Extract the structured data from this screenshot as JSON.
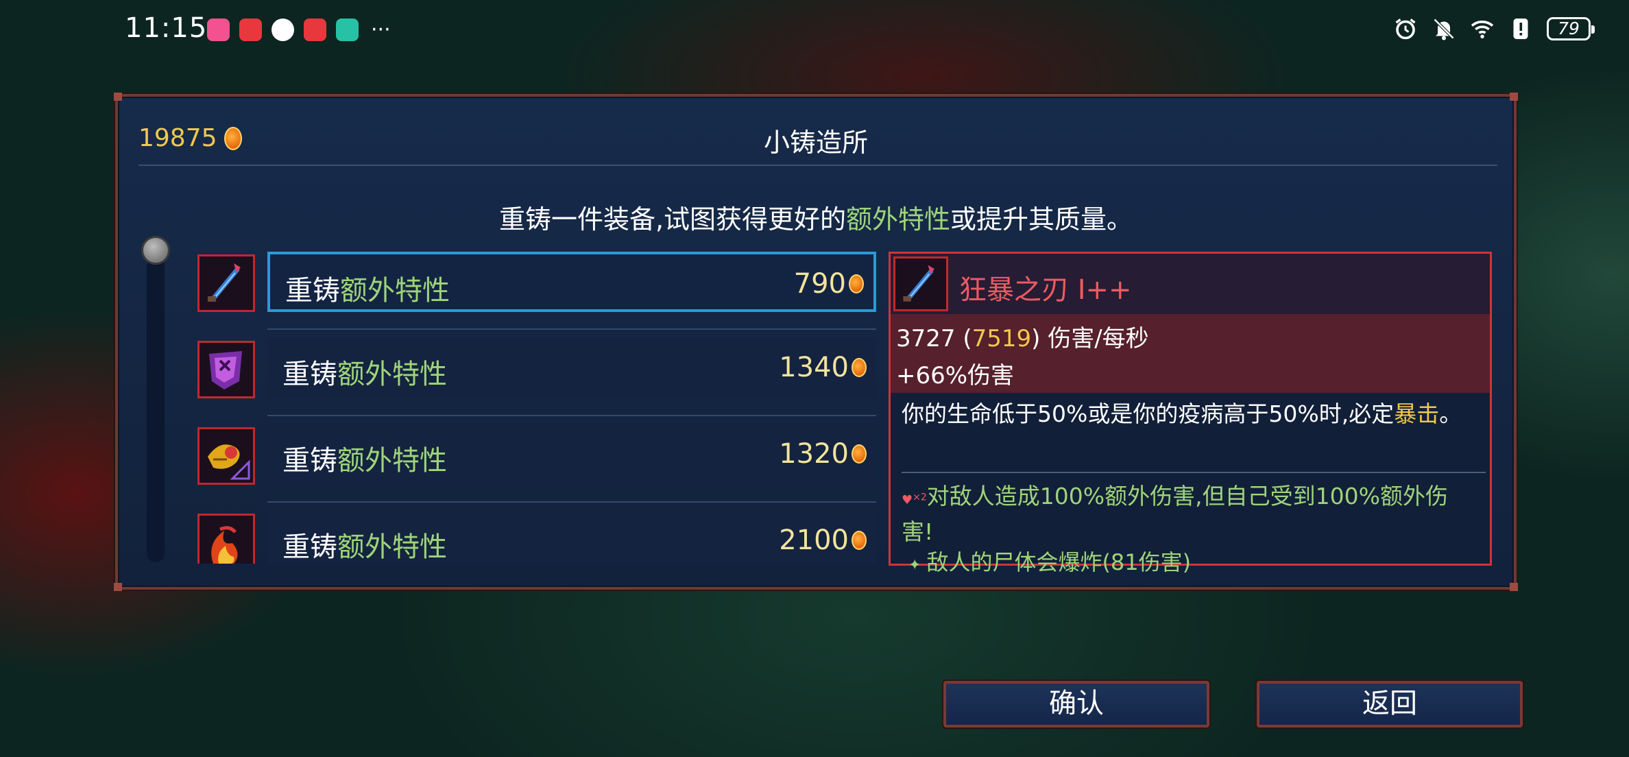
{
  "status_bar": {
    "time": "11:15",
    "app_icons": [
      {
        "name": "bilibili-icon",
        "color": "#f2528f"
      },
      {
        "name": "huawei-icon",
        "color": "#e8383d"
      },
      {
        "name": "qq-icon",
        "color": "#ffffff"
      },
      {
        "name": "mail-icon",
        "color": "#e8383d"
      },
      {
        "name": "shield-app-icon",
        "color": "#27c2a6"
      }
    ],
    "more": "···",
    "battery": "79"
  },
  "dialog": {
    "gold": "19875",
    "title": "小铸造所",
    "subtitle_prefix": "重铸一件装备,试图获得更好的",
    "subtitle_highlight": "额外特性",
    "subtitle_suffix": "或提升其质量。"
  },
  "list": {
    "items": [
      {
        "prefix": "重铸",
        "highlight": "额外特性",
        "cost": "790",
        "icon": "berserker-blade-icon",
        "selected": true
      },
      {
        "prefix": "重铸",
        "highlight": "额外特性",
        "cost": "1340",
        "icon": "purple-shield-icon",
        "selected": false
      },
      {
        "prefix": "重铸",
        "highlight": "额外特性",
        "cost": "1320",
        "icon": "golden-dragon-icon",
        "selected": false
      },
      {
        "prefix": "重铸",
        "highlight": "额外特性",
        "cost": "2100",
        "icon": "fire-skill-icon",
        "selected": false
      }
    ]
  },
  "detail": {
    "name": "狂暴之刃 I++",
    "dps_base": "3727",
    "dps_open": " (",
    "dps_crit": "7519",
    "dps_close": ") 伤害/每秒",
    "damage_bonus": "+66%伤害",
    "desc_main": "你的生命低于50%或是你的疫病高于50%时,必定",
    "desc_highlight": "暴击",
    "desc_end": "。",
    "bonus_mult": "×2",
    "bonus_text": "对敌人造成100%额外伤害,但自己受到100%额外伤害!",
    "bonus2_text": "敌人的尸体会爆炸(81伤害)"
  },
  "buttons": {
    "confirm": "确认",
    "back": "返回"
  }
}
